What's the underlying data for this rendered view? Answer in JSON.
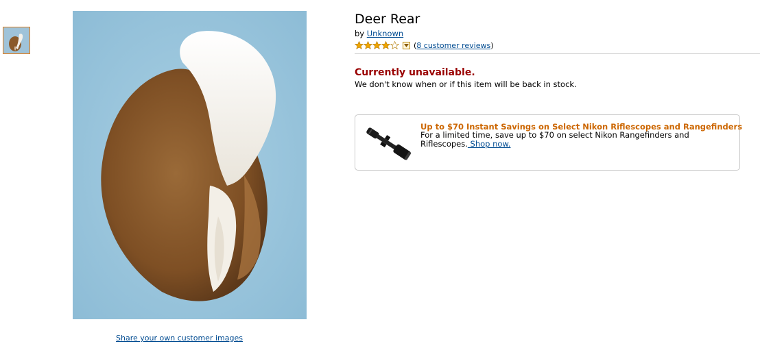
{
  "product": {
    "title": "Deer Rear",
    "by_prefix": "by",
    "author": "Unknown",
    "rating_stars": 4,
    "rating_max": 5,
    "reviews_open": "(",
    "reviews_link": "8 customer reviews",
    "reviews_close": ")"
  },
  "availability": {
    "status": "Currently unavailable.",
    "note": "We don't know when or if this item will be back in stock."
  },
  "images": {
    "thumbnail_icon": "deer-rear-thumbnail",
    "main_icon": "deer-rear-photo",
    "share_link": "Share your own customer images"
  },
  "promo": {
    "title": "Up to $70 Instant Savings on Select Nikon Riflescopes and Rangefinders",
    "text": "For a limited time, save up to $70 on select Nikon Rangefinders and Riflescopes.",
    "link": " Shop now.",
    "icon": "riflescope-image"
  },
  "colors": {
    "link": "#004b91",
    "unavailable": "#990000",
    "promo_title": "#cc6600",
    "star": "#f0a500",
    "thumb_border": "#e47911"
  }
}
